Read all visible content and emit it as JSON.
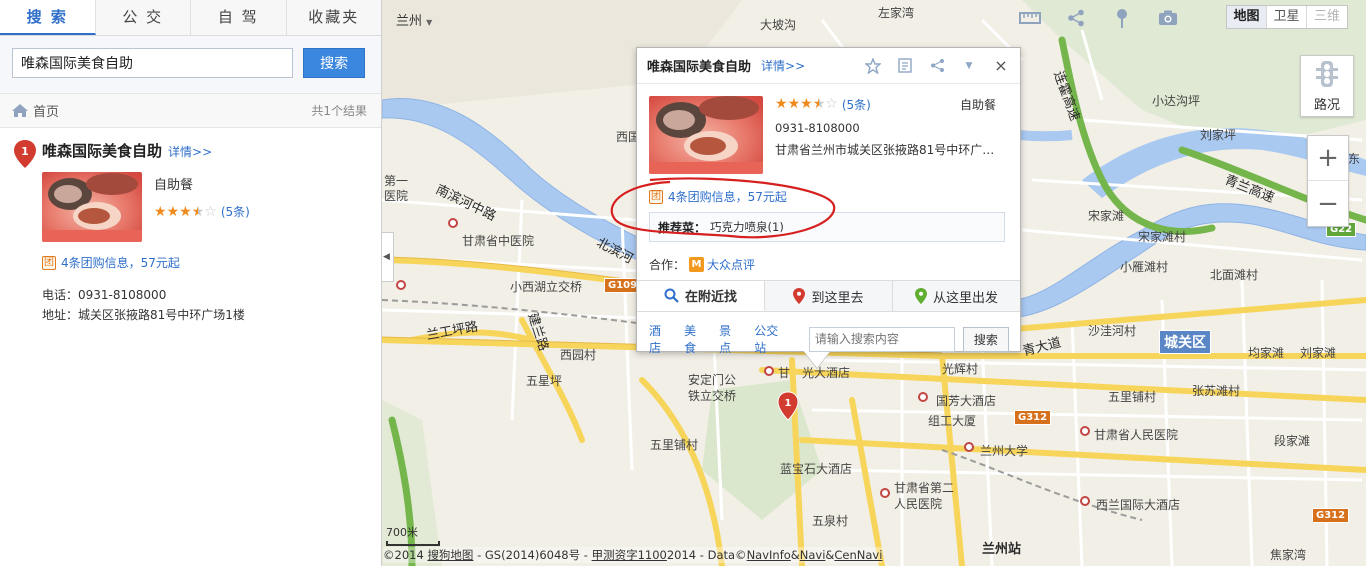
{
  "tabs": [
    {
      "label": "搜 索",
      "active": true
    },
    {
      "label": "公 交",
      "active": false
    },
    {
      "label": "自 驾",
      "active": false
    },
    {
      "label": "收藏夹",
      "active": false
    }
  ],
  "search": {
    "value": "唯森国际美食自助",
    "button": "搜索"
  },
  "crumb": {
    "home": "首页",
    "count": "共1个结果"
  },
  "result": {
    "marker": "1",
    "name": "唯森国际美食自助",
    "detail": "详情>>",
    "category": "自助餐",
    "rating": 3.5,
    "reviews": "(5条)",
    "deal_icon": "团",
    "deal": "4条团购信息，57元起",
    "phone_label": "电话：",
    "phone": "0931-8108000",
    "address_label": "地址：",
    "address": "城关区张掖路81号中环广场1楼"
  },
  "map": {
    "city": "兰州",
    "maptypes": [
      "地图",
      "卫星",
      "三维"
    ],
    "active_maptype": "地图",
    "traffic": "路况",
    "zoom_in": "+",
    "zoom_out": "−",
    "scale": "700米",
    "copyright": {
      "prefix": "©2014",
      "brand": "搜狗地图",
      "gs": "- GS(2014)6048号 -",
      "survey": "甲测资字1100",
      "year": "2014",
      "data": "- Data©",
      "navinfo": "NavInfo",
      "amp": "&",
      "navi": "Navi",
      "amp2": "&",
      "cennavi": "CenNavi"
    },
    "labels": {
      "dabosou": "大坡沟",
      "zuojiawan": "左家湾",
      "xiaodashagou": "小达沟坪",
      "liujiaping": "刘家坪",
      "xigu": "西国",
      "diyi_yiyuan": "第一\n医院",
      "gansu_zhongyiyuan": "甘肃省中医院",
      "nanbinhe": "南滨河中路",
      "beibin": "北滨河",
      "xiaoxihu": "小西湖立交桥",
      "lanyangping": "兰工坪路",
      "jianlan": "建兰路",
      "xiyuancun": "西园村",
      "wulipu_w": "五星坪",
      "anding": "安定门公\n铁立交桥",
      "wulipu": "五里铺村",
      "gansu_hotel": "甘",
      "guangmin_hotel": "光大酒店",
      "guofang": "国芳大酒店",
      "zuxin": "组工大厦",
      "lzdx": "兰州大学",
      "lanbaoshi": "蓝宝石大酒店",
      "gansu_2": "甘肃省第二\n人民医院",
      "wuquan": "五泉村",
      "lanzhou_station": "兰州站",
      "xijiang": "西兰国际大酒店",
      "gansu_people": "甘肃省人民医院",
      "songjiatan": "宋家滩",
      "songjiatancun": "宋家滩村",
      "xiaoyan": "小雁滩村",
      "beimian": "北面滩村",
      "shaohecun": "沙洼河村",
      "chengguan": "城关区",
      "junjiatan": "均家滩",
      "liujiatan": "刘家滩",
      "wulipucun": "五里铺村",
      "zhangsu": "张苏滩村",
      "duanjiatan": "段家滩",
      "jiaojiawan": "焦家湾",
      "qingjiang": "青大道",
      "guangping": "光辉村",
      "ziqing": "青兰高速",
      "lianhuo": "连霍高速",
      "dongmen": "东",
      "dongdong": "东岗"
    },
    "highways": [
      "G109",
      "G312",
      "G312",
      "G22"
    ]
  },
  "popup": {
    "title": "唯森国际美食自助",
    "detail": "详情>>",
    "rating": 3.5,
    "reviews": "(5条)",
    "category": "自助餐",
    "phone": "0931-8108000",
    "address": "甘肃省兰州市城关区张掖路81号中环广场1楼",
    "deal_icon": "团",
    "deal": "4条团购信息，57元起",
    "rec_label": "推荐菜：",
    "rec_value": "巧克力喷泉(1)",
    "partner_label": "合作：",
    "partner_logo": "M",
    "partner_name": "大众点评",
    "tabs": [
      "在附近找",
      "到这里去",
      "从这里出发"
    ],
    "categories": [
      "酒店",
      "美食",
      "景点",
      "公交站"
    ],
    "nearby_placeholder": "请输入搜索内容",
    "nearby_button": "搜索",
    "close": "×",
    "marker": "1"
  },
  "colors": {
    "accent": "#2f6fc9",
    "search_button": "#3b86de",
    "river": "#a9c9f1",
    "marker": "#d23b2f",
    "annotation": "#d62020",
    "star": "#f08a1c"
  }
}
